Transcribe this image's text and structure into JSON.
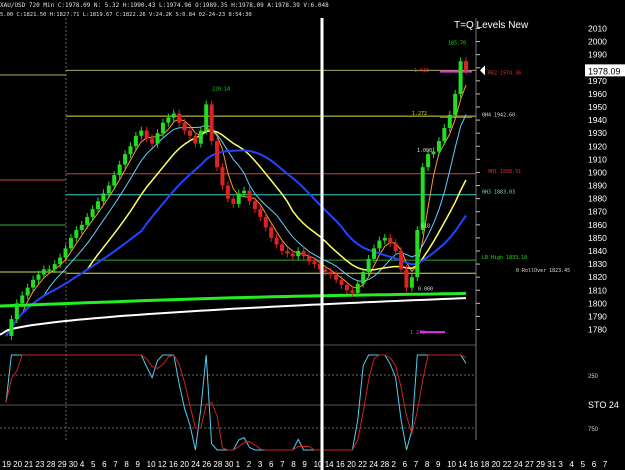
{
  "header": {
    "info": "XAU/USD 720 Min C:1978.09 N: 5.32 H:1990.43 L:1974.96 O:1989.35 H:1978.09 A:1978.39 V:6.048",
    "info2": "5.00 C:1821.50 H:1827.71 L:1819.67 C:1822.26 V:24.2K S:0.84 02-24-23 8:54:30"
  },
  "title": "T=Q Levels New",
  "chart_data": {
    "type": "line",
    "title": "T=Q Levels New",
    "price_axis": {
      "ylim": [
        1772,
        2018
      ],
      "ticks": [
        2010,
        2000,
        1990,
        1980,
        1970,
        1960,
        1950,
        1940,
        1930,
        1920,
        1910,
        1900,
        1890,
        1880,
        1870,
        1860,
        1850,
        1840,
        1830,
        1820,
        1810,
        1800,
        1790,
        1780
      ],
      "last_price": "1978.09"
    },
    "date_labels": [
      "19",
      "20",
      "21",
      "23",
      "28",
      "29",
      "30",
      "4",
      "5",
      "6",
      "7",
      "8",
      "9",
      "10",
      "12",
      "16",
      "20",
      "24",
      "26",
      "28",
      "30",
      "1",
      "2",
      "3",
      "6",
      "7",
      "8",
      "9",
      "10",
      "14",
      "16",
      "20",
      "22",
      "24",
      "28",
      "2",
      "6",
      "7",
      "8",
      "9",
      "10",
      "14",
      "16",
      "18",
      "20",
      "22",
      "24",
      "27",
      "29",
      "31",
      "3",
      "4",
      "5",
      "6",
      "7"
    ],
    "annotations": [
      {
        "text": "220.14",
        "price": 1962,
        "color": "#22dd22"
      },
      {
        "text": "185.70",
        "price": 1997,
        "color": "#22dd22"
      },
      {
        "text": "1.618",
        "price": 1976,
        "color": "#dd3333"
      },
      {
        "text": "RR2 1974.36",
        "price": 1974,
        "color": "#dd3333"
      },
      {
        "text": "1.272",
        "price": 1943,
        "color": "#dddd00"
      },
      {
        "text": "0H4 1942.60",
        "price": 1942,
        "color": "#dddddd"
      },
      {
        "text": "1.000",
        "price": 1915,
        "color": "#dddddd"
      },
      {
        "text": "0H1 1898.91",
        "price": 1899,
        "color": "#dd3333"
      },
      {
        "text": "0H3 1883.03",
        "price": 1883,
        "color": "#66dddd"
      },
      {
        "text": ".618",
        "price": 1857,
        "color": "#dddddd"
      },
      {
        "text": "LB High 1833.18",
        "price": 1833,
        "color": "#22dd22"
      },
      {
        "text": "0 RollOver 1823.45",
        "price": 1823,
        "color": "#dddddd"
      },
      {
        "text": "0.000",
        "price": 1809,
        "color": "#dddddd"
      },
      {
        "text": "1.272",
        "price": 1776,
        "color": "#dd33dd"
      }
    ],
    "hlines": [
      {
        "price": 1978,
        "color": "#aaaa66"
      },
      {
        "price": 1943,
        "color": "#dddd44"
      },
      {
        "price": 1899,
        "color": "#cc4444"
      },
      {
        "price": 1883,
        "color": "#44cccc"
      },
      {
        "price": 1833,
        "color": "#33aa33"
      },
      {
        "price": 1823,
        "color": "#dddd44"
      }
    ],
    "close_series": [
      1775,
      1788,
      1800,
      1806,
      1812,
      1818,
      1822,
      1826,
      1826,
      1830,
      1835,
      1842,
      1850,
      1856,
      1860,
      1866,
      1872,
      1878,
      1884,
      1890,
      1898,
      1906,
      1914,
      1920,
      1928,
      1932,
      1926,
      1922,
      1930,
      1938,
      1942,
      1945,
      1938,
      1932,
      1928,
      1922,
      1932,
      1952,
      1924,
      1904,
      1890,
      1880,
      1876,
      1884,
      1886,
      1878,
      1872,
      1866,
      1858,
      1850,
      1845,
      1840,
      1838,
      1836,
      1840,
      1836,
      1832,
      1830,
      1826,
      1824,
      1822,
      1818,
      1814,
      1810,
      1808,
      1815,
      1824,
      1834,
      1842,
      1848,
      1850,
      1846,
      1840,
      1826,
      1812,
      1820,
      1856,
      1904,
      1914,
      1916,
      1924,
      1934,
      1944,
      1960,
      1985,
      1978
    ],
    "oscillator": {
      "levels": [
        750,
        250
      ],
      "tick_labels": [
        "250",
        "750"
      ],
      "label": "STO 24"
    }
  }
}
